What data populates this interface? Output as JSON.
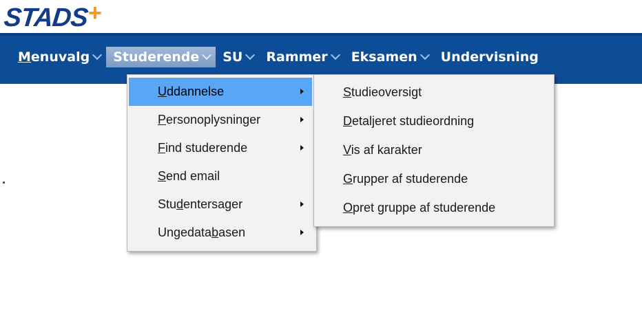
{
  "logo": {
    "text": "STADS",
    "plus": "+"
  },
  "colors": {
    "menubar": "#0d4d97",
    "highlight": "#58a6f5",
    "logo_blue": "#123c88",
    "logo_orange": "#f29a1c"
  },
  "menubar": {
    "items": [
      {
        "accel": "M",
        "rest": "enuvalg"
      },
      {
        "accel": "",
        "rest": "Studerende"
      },
      {
        "accel": "",
        "rest": "SU"
      },
      {
        "accel": "",
        "rest": "Rammer"
      },
      {
        "accel": "",
        "rest": "Eksamen"
      },
      {
        "accel": "",
        "rest": "Undervisning"
      }
    ],
    "active_index": 1
  },
  "dropdown": {
    "items": [
      {
        "pre": "",
        "accel": "U",
        "post": "ddannelse",
        "has_submenu": true
      },
      {
        "pre": "",
        "accel": "P",
        "post": "ersonoplysninger",
        "has_submenu": true
      },
      {
        "pre": "",
        "accel": "F",
        "post": "ind studerende",
        "has_submenu": true
      },
      {
        "pre": "",
        "accel": "S",
        "post": "end email",
        "has_submenu": false
      },
      {
        "pre": "Stu",
        "accel": "d",
        "post": "entersager",
        "has_submenu": true
      },
      {
        "pre": "Ungedata",
        "accel": "b",
        "post": "asen",
        "has_submenu": true
      }
    ],
    "highlighted_index": 0
  },
  "submenu": {
    "items": [
      {
        "pre": "",
        "accel": "S",
        "post": "tudieoversigt"
      },
      {
        "pre": "",
        "accel": "D",
        "post": "etaljeret studieordning"
      },
      {
        "pre": "",
        "accel": "V",
        "post": "is af karakter"
      },
      {
        "pre": "",
        "accel": "G",
        "post": "rupper af studerende"
      },
      {
        "pre": "",
        "accel": "O",
        "post": "pret gruppe af studerende"
      }
    ]
  }
}
